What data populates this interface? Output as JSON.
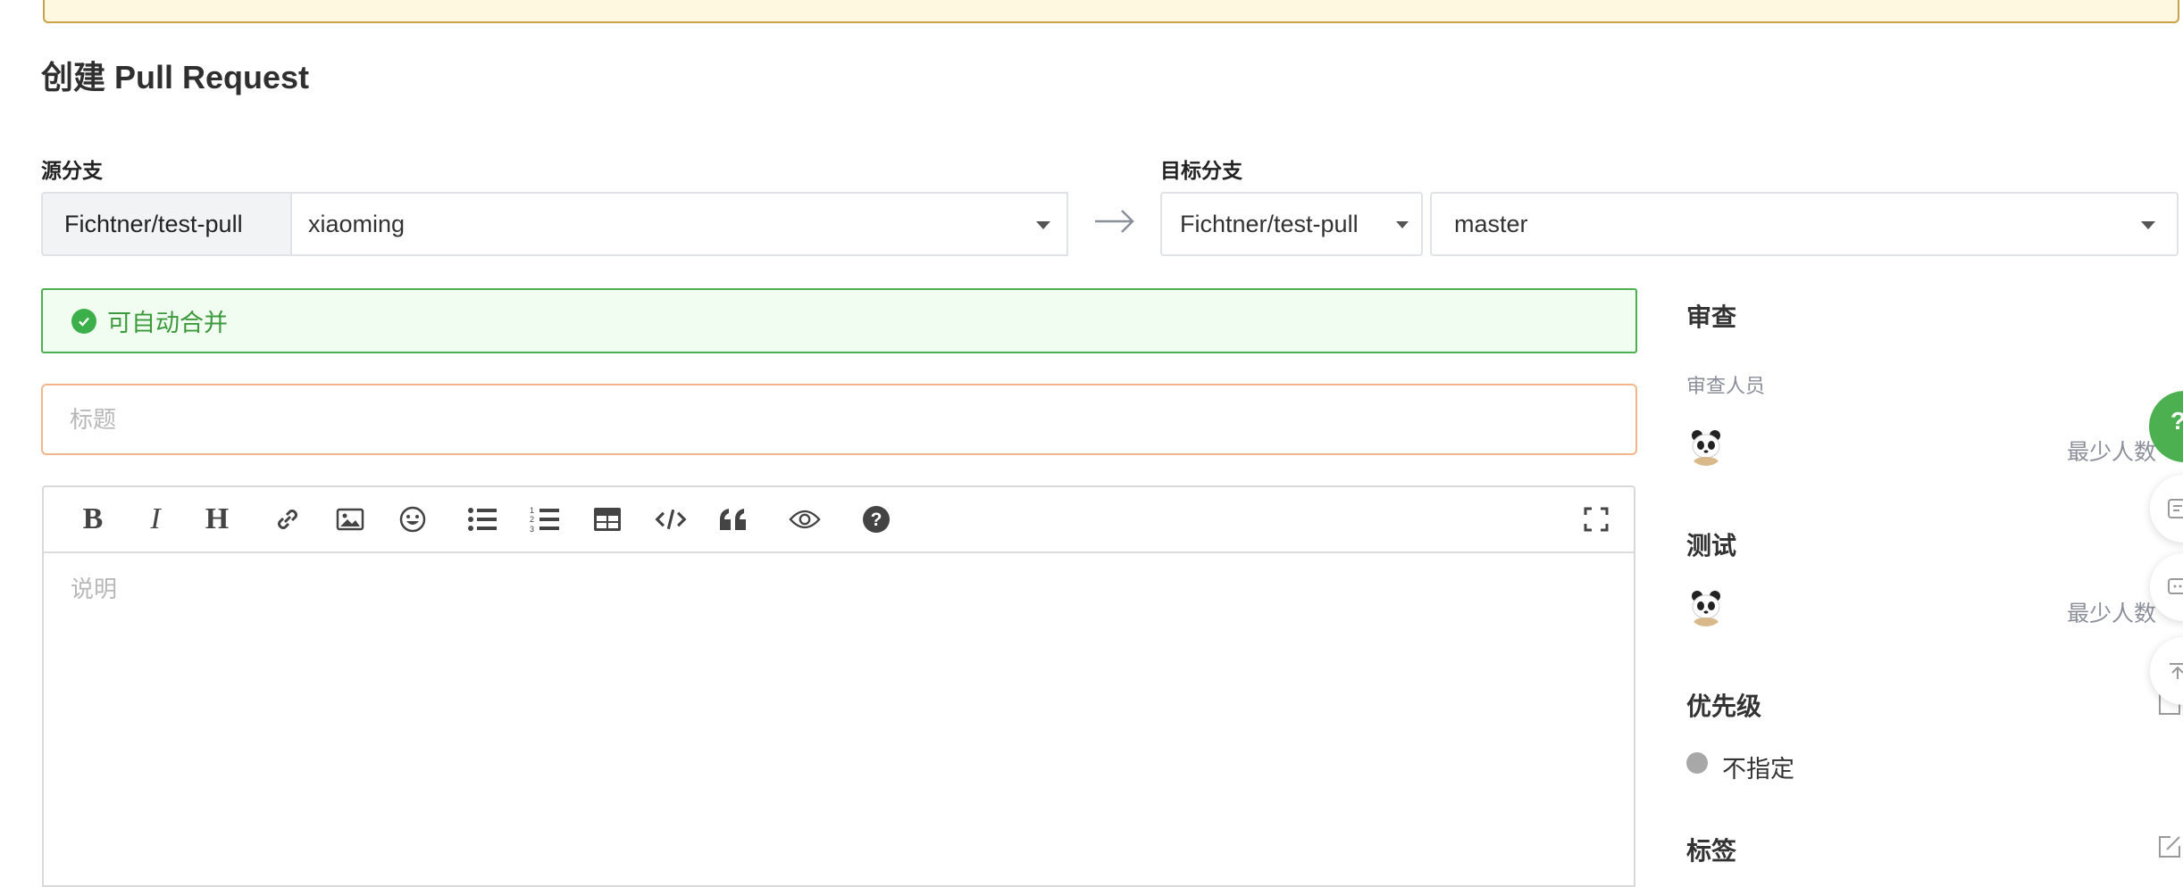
{
  "page": {
    "title": "创建 Pull Request"
  },
  "source": {
    "label": "源分支",
    "repo": "Fichtner/test-pull",
    "branch": "xiaoming"
  },
  "target": {
    "label": "目标分支",
    "repo": "Fichtner/test-pull",
    "branch": "master"
  },
  "merge_status": {
    "text": "可自动合并",
    "color": "#3bb04a"
  },
  "form": {
    "title_placeholder": "标题",
    "description_placeholder": "说明"
  },
  "toolbar": {
    "buttons": [
      "bold-icon",
      "italic-icon",
      "heading-icon",
      "link-icon",
      "image-icon",
      "emoji-icon",
      "bullet-list-icon",
      "numbered-list-icon",
      "table-icon",
      "code-icon",
      "quote-icon",
      "preview-icon",
      "help-icon",
      "fullscreen-icon"
    ]
  },
  "sidebar": {
    "review": {
      "heading": "审查",
      "reviewers_label": "审查人员",
      "min_count_text": "最少人数"
    },
    "test": {
      "heading": "测试",
      "min_count_text": "最少人数"
    },
    "priority": {
      "heading": "优先级",
      "value": "不指定",
      "dot_color": "#a8a8a8"
    },
    "labels": {
      "heading": "标签"
    }
  },
  "colors": {
    "accent_green": "#4caf50",
    "warning_border": "#c9a24a",
    "title_input_border": "#f2b58c"
  }
}
